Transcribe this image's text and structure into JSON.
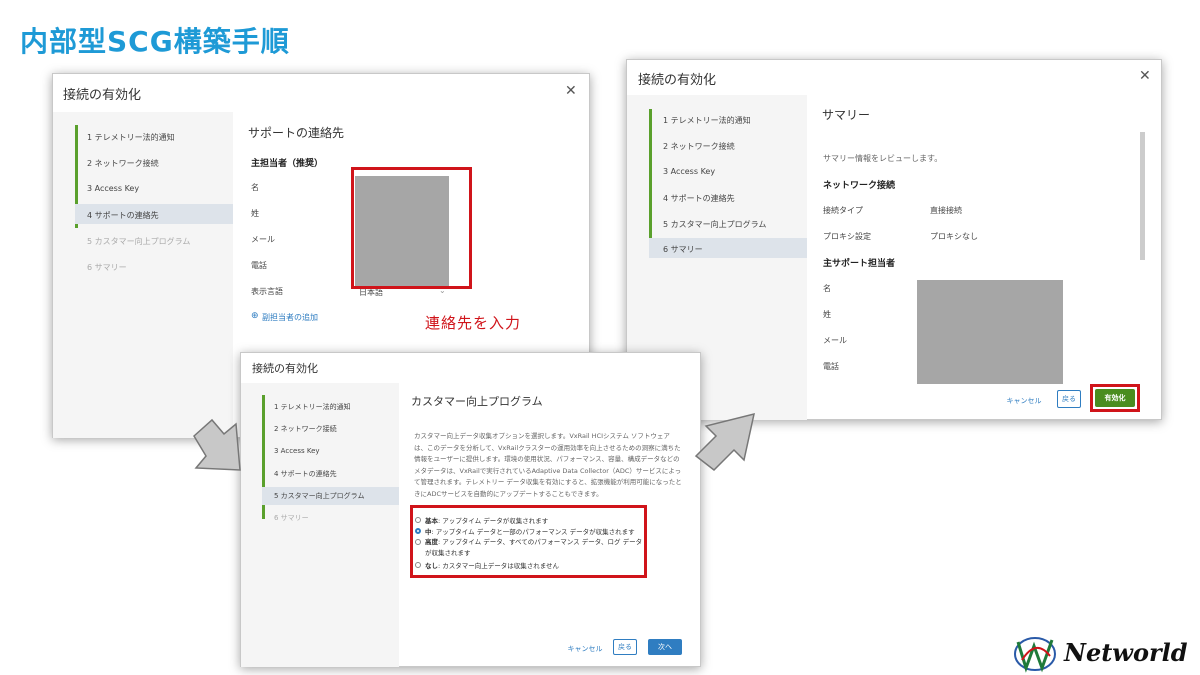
{
  "page_title": "内部型SCG構築手順",
  "logo_text": "Networld",
  "dialog1": {
    "title": "接続の有効化",
    "steps": [
      "1 テレメトリー法的通知",
      "2 ネットワーク接続",
      "3 Access Key",
      "4 サポートの連絡先",
      "5 カスタマー向上プログラム",
      "6 サマリー"
    ],
    "section_title": "サポートの連絡先",
    "primary_label": "主担当者（推奨）",
    "fields": [
      "名",
      "姓",
      "メール",
      "電話",
      "表示言語"
    ],
    "language_value": "日本語",
    "add_secondary": "副担当者の追加",
    "annotation": "連絡先を入力"
  },
  "dialog2": {
    "title": "接続の有効化",
    "steps": [
      "1 テレメトリー法的通知",
      "2 ネットワーク接続",
      "3 Access Key",
      "4 サポートの連絡先",
      "5 カスタマー向上プログラム",
      "6 サマリー"
    ],
    "section_title": "カスタマー向上プログラム",
    "description": "カスタマー向上データ収集オプションを選択します。VxRail HCIシステム ソフトウェアは、このデータを分析して、VxRailクラスターの運用効率を向上させるための洞察に満ちた情報をユーザーに提供します。環境の使用状況、パフォーマンス、容量、構成データなどのメタデータは、VxRailで実行されているAdaptive Data Collector（ADC）サービスによって管理されます。テレメトリー データ収集を有効にすると、拡張機能が利用可能になったときにADCサービスを自動的にアップデートすることもできます。",
    "options": [
      {
        "name": "基本",
        "text": ": アップタイム データが収集されます"
      },
      {
        "name": "中",
        "text": ": アップタイム データと一部のパフォーマンス データが収集されます"
      },
      {
        "name": "高度",
        "text": ": アップタイム データ、すべてのパフォーマンス データ、ログ データが収集されます"
      },
      {
        "name": "なし",
        "text": ": カスタマー向上データは収集されません"
      }
    ],
    "cancel": "キャンセル",
    "back": "戻る",
    "next": "次へ"
  },
  "dialog3": {
    "title": "接続の有効化",
    "steps": [
      "1 テレメトリー法的通知",
      "2 ネットワーク接続",
      "3 Access Key",
      "4 サポートの連絡先",
      "5 カスタマー向上プログラム",
      "6 サマリー"
    ],
    "section_title": "サマリー",
    "review_text": "サマリー情報をレビューします。",
    "network_heading": "ネットワーク接続",
    "connection_type_label": "接続タイプ",
    "connection_type_value": "直接接続",
    "proxy_label": "プロキシ設定",
    "proxy_value": "プロキシなし",
    "primary_heading": "主サポート担当者",
    "fields": [
      "名",
      "姓",
      "メール",
      "電話"
    ],
    "cancel": "キャンセル",
    "back": "戻る",
    "enable": "有効化"
  },
  "colors": {
    "title_blue": "#1e9ad6",
    "step_green": "#5aa02c",
    "annotation_red": "#d0141a",
    "primary_blue": "#2f7dc1",
    "enable_green": "#4a8d1f"
  },
  "icons": [
    "close-icon",
    "add-circle-icon",
    "chevron-down-icon",
    "arrow-right-icon",
    "networld-logo-icon"
  ]
}
